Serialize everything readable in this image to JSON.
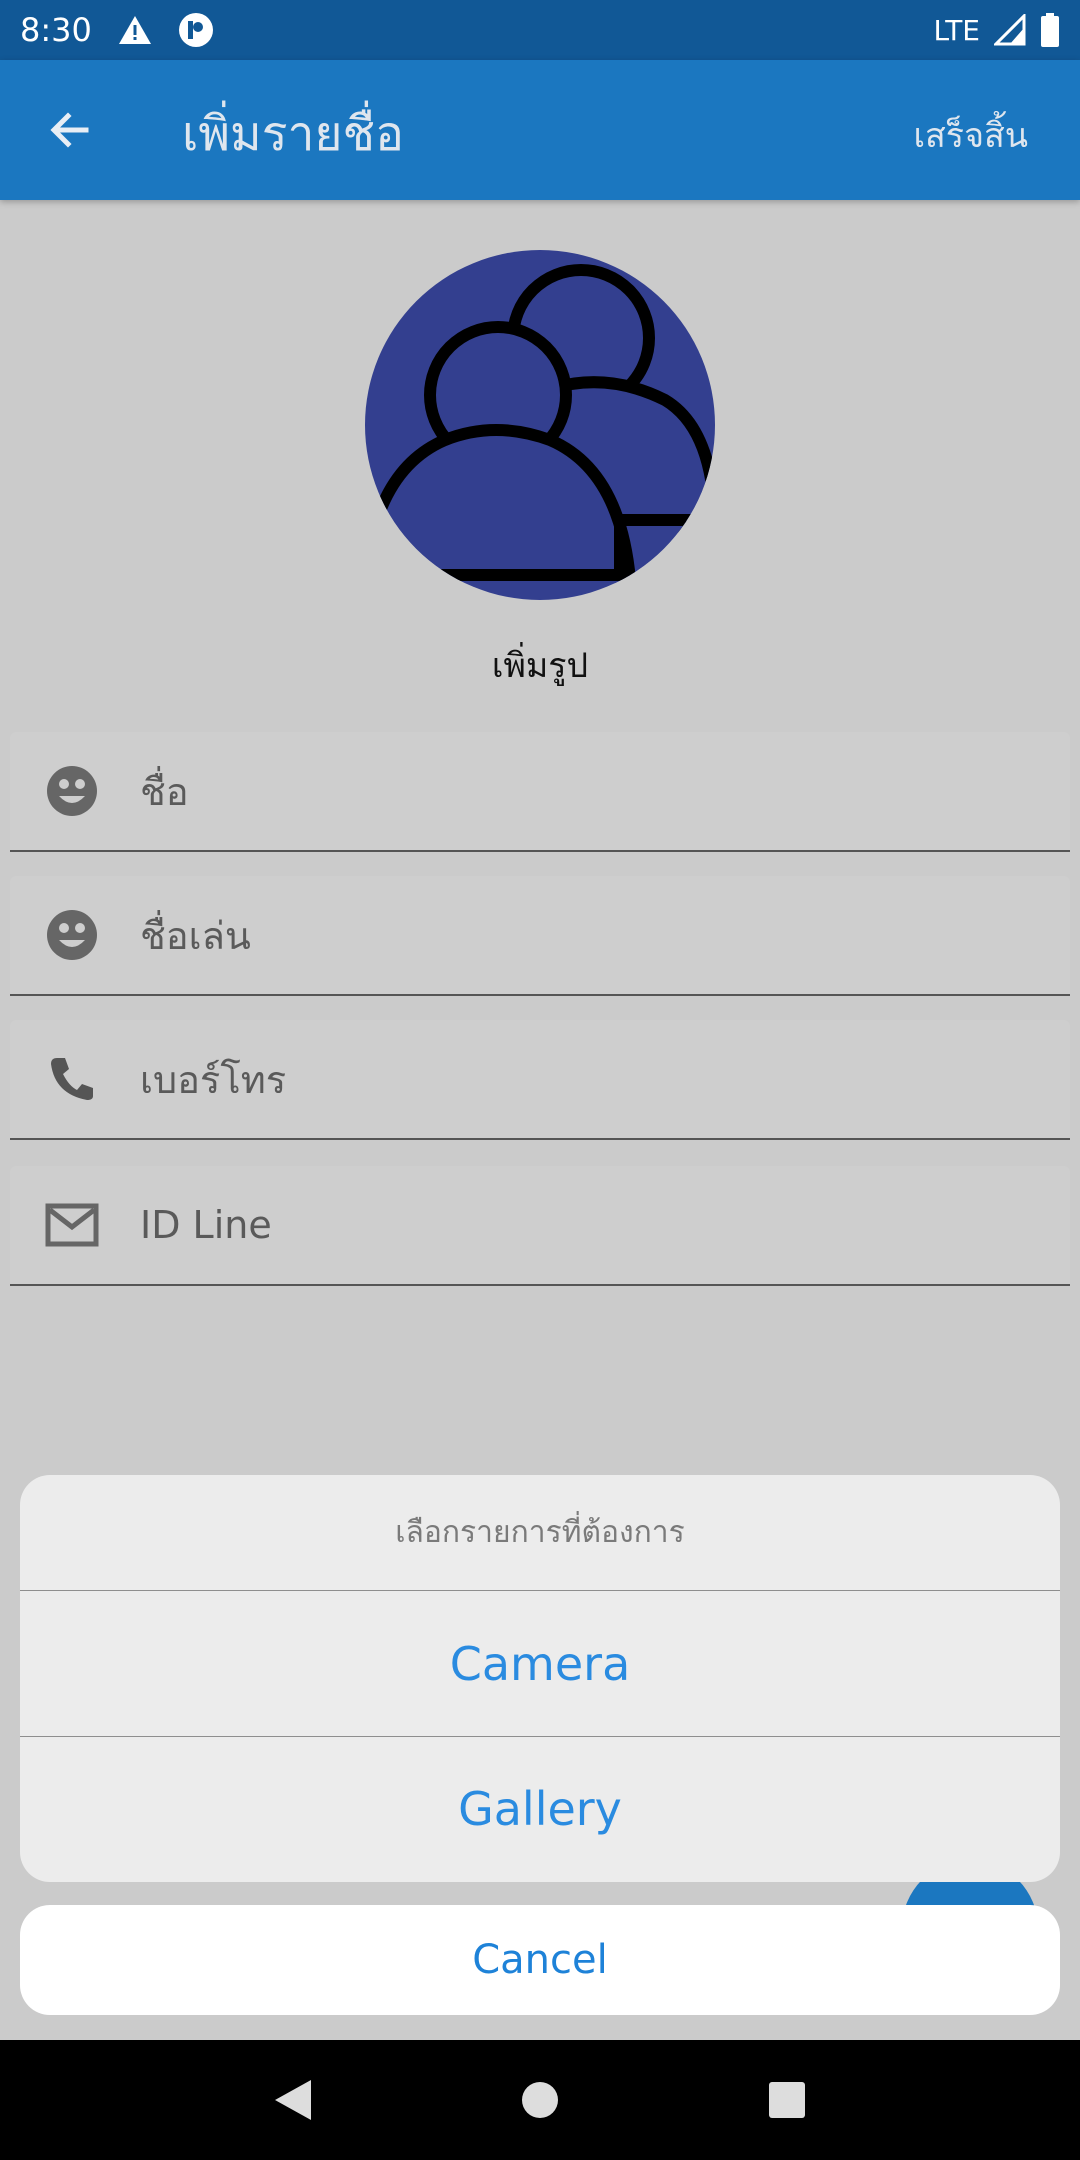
{
  "status_bar": {
    "time": "8:30",
    "network": "LTE"
  },
  "app_bar": {
    "title": "เพิ่มรายชื่อ",
    "done_label": "เสร็จสิ้น"
  },
  "profile": {
    "add_photo_label": "เพิ่มรูป"
  },
  "fields": [
    {
      "icon": "face-icon",
      "placeholder": "ชื่อ"
    },
    {
      "icon": "face-icon",
      "placeholder": "ชื่อเล่น"
    },
    {
      "icon": "phone-icon",
      "placeholder": "เบอร์โทร"
    },
    {
      "icon": "mail-icon",
      "placeholder": "ID Line"
    }
  ],
  "action_sheet": {
    "title": "เลือกรายการที่ต้องการ",
    "options": [
      "Camera",
      "Gallery"
    ],
    "cancel_label": "Cancel"
  },
  "colors": {
    "app_bar": "#1b77c0",
    "status_bar": "#115896",
    "avatar_bg": "#333f8f",
    "action_text": "#2a8be0"
  }
}
